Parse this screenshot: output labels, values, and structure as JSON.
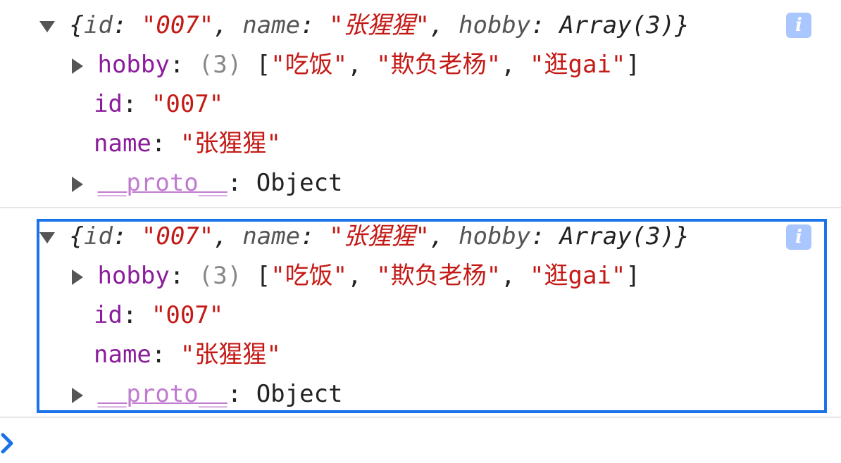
{
  "entries": [
    {
      "summary": {
        "open_brace": "{",
        "close_brace": "}",
        "id_key": "id",
        "id_val": "\"007\"",
        "name_key": "name",
        "name_val": "\"张猩猩\"",
        "hobby_key": "hobby",
        "hobby_val": "Array(3)",
        "colon": ":",
        "comma": ","
      },
      "hobby": {
        "key": "hobby",
        "count": "(3)",
        "items": [
          "\"吃饭\"",
          "\"欺负老杨\"",
          "\"逛gai\""
        ],
        "open": "[",
        "close": "]"
      },
      "id": {
        "key": "id",
        "value": "\"007\""
      },
      "name": {
        "key": "name",
        "value": "\"张猩猩\""
      },
      "proto": {
        "key": "__proto__",
        "value": "Object"
      },
      "info_label": "i"
    },
    {
      "summary": {
        "open_brace": "{",
        "close_brace": "}",
        "id_key": "id",
        "id_val": "\"007\"",
        "name_key": "name",
        "name_val": "\"张猩猩\"",
        "hobby_key": "hobby",
        "hobby_val": "Array(3)",
        "colon": ":",
        "comma": ","
      },
      "hobby": {
        "key": "hobby",
        "count": "(3)",
        "items": [
          "\"吃饭\"",
          "\"欺负老杨\"",
          "\"逛gai\""
        ],
        "open": "[",
        "close": "]"
      },
      "id": {
        "key": "id",
        "value": "\"007\""
      },
      "name": {
        "key": "name",
        "value": "\"张猩猩\""
      },
      "proto": {
        "key": "__proto__",
        "value": "Object"
      },
      "info_label": "i"
    }
  ],
  "prompt_symbol": "›",
  "colors": {
    "key": "#8b1c9c",
    "string": "#c41a16",
    "highlight": "#1a73e8",
    "info_badge": "#a9c6ff"
  }
}
